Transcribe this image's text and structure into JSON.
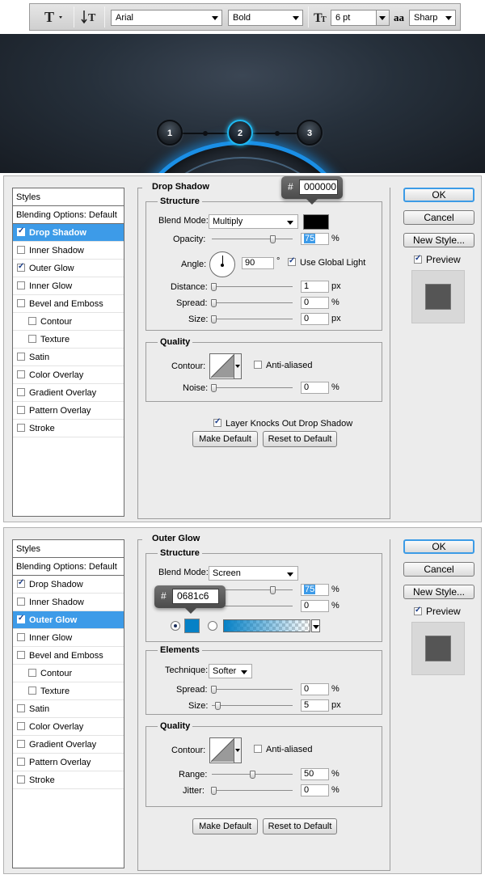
{
  "toolbar": {
    "font_family": "Arial",
    "font_style": "Bold",
    "font_size": "6 pt",
    "aa_icon": "aa",
    "antialias": "Sharp"
  },
  "hero": {
    "steps": [
      "1",
      "2",
      "3"
    ],
    "active_step": "2",
    "glow_color": "#1fb8f0"
  },
  "panel1": {
    "styles_header": "Styles",
    "blending_options": "Blending Options: Default",
    "items": [
      {
        "label": "Drop Shadow",
        "checked": true,
        "selected": true
      },
      {
        "label": "Inner Shadow",
        "checked": false
      },
      {
        "label": "Outer Glow",
        "checked": true
      },
      {
        "label": "Inner Glow",
        "checked": false
      },
      {
        "label": "Bevel and Emboss",
        "checked": false
      },
      {
        "label": "Contour",
        "checked": false,
        "sub": true
      },
      {
        "label": "Texture",
        "checked": false,
        "sub": true
      },
      {
        "label": "Satin",
        "checked": false
      },
      {
        "label": "Color Overlay",
        "checked": false
      },
      {
        "label": "Gradient Overlay",
        "checked": false
      },
      {
        "label": "Pattern Overlay",
        "checked": false
      },
      {
        "label": "Stroke",
        "checked": false
      }
    ],
    "title": "Drop Shadow",
    "structure": "Structure",
    "blend_mode_label": "Blend Mode:",
    "blend_mode": "Multiply",
    "shadow_color": "#000000",
    "hex_hash": "#",
    "hex_value": "000000",
    "opacity_label": "Opacity:",
    "opacity": "75",
    "opacity_fraction": 0.75,
    "percent": "%",
    "px": "px",
    "angle_label": "Angle:",
    "angle": "90",
    "degree": "°",
    "use_global_light": "Use Global Light",
    "distance_label": "Distance:",
    "distance": "1",
    "spread_label": "Spread:",
    "spread": "0",
    "size_label": "Size:",
    "size": "0",
    "quality": "Quality",
    "contour_label": "Contour:",
    "anti_aliased": "Anti-aliased",
    "noise_label": "Noise:",
    "noise": "0",
    "layer_knocks_out": "Layer Knocks Out Drop Shadow",
    "make_default": "Make Default",
    "reset_to_default": "Reset to Default"
  },
  "panel2": {
    "styles_header": "Styles",
    "blending_options": "Blending Options: Default",
    "items": [
      {
        "label": "Drop Shadow",
        "checked": true
      },
      {
        "label": "Inner Shadow",
        "checked": false
      },
      {
        "label": "Outer Glow",
        "checked": true,
        "selected": true
      },
      {
        "label": "Inner Glow",
        "checked": false
      },
      {
        "label": "Bevel and Emboss",
        "checked": false
      },
      {
        "label": "Contour",
        "checked": false,
        "sub": true
      },
      {
        "label": "Texture",
        "checked": false,
        "sub": true
      },
      {
        "label": "Satin",
        "checked": false
      },
      {
        "label": "Color Overlay",
        "checked": false
      },
      {
        "label": "Gradient Overlay",
        "checked": false
      },
      {
        "label": "Pattern Overlay",
        "checked": false
      },
      {
        "label": "Stroke",
        "checked": false
      }
    ],
    "title": "Outer Glow",
    "structure": "Structure",
    "blend_mode_label": "Blend Mode:",
    "blend_mode": "Screen",
    "opacity": "75",
    "noise": "0",
    "percent": "%",
    "px": "px",
    "glow_color": "#0681c6",
    "hex_hash": "#",
    "hex_value": "0681c6",
    "elements": "Elements",
    "technique_label": "Technique:",
    "technique": "Softer",
    "spread_label": "Spread:",
    "spread": "0",
    "size_label": "Size:",
    "size": "5",
    "quality": "Quality",
    "contour_label": "Contour:",
    "anti_aliased": "Anti-aliased",
    "range_label": "Range:",
    "range": "50",
    "jitter_label": "Jitter:",
    "jitter": "0",
    "make_default": "Make Default",
    "reset_to_default": "Reset to Default"
  },
  "buttons": {
    "ok": "OK",
    "cancel": "Cancel",
    "new_style": "New Style...",
    "preview": "Preview"
  }
}
